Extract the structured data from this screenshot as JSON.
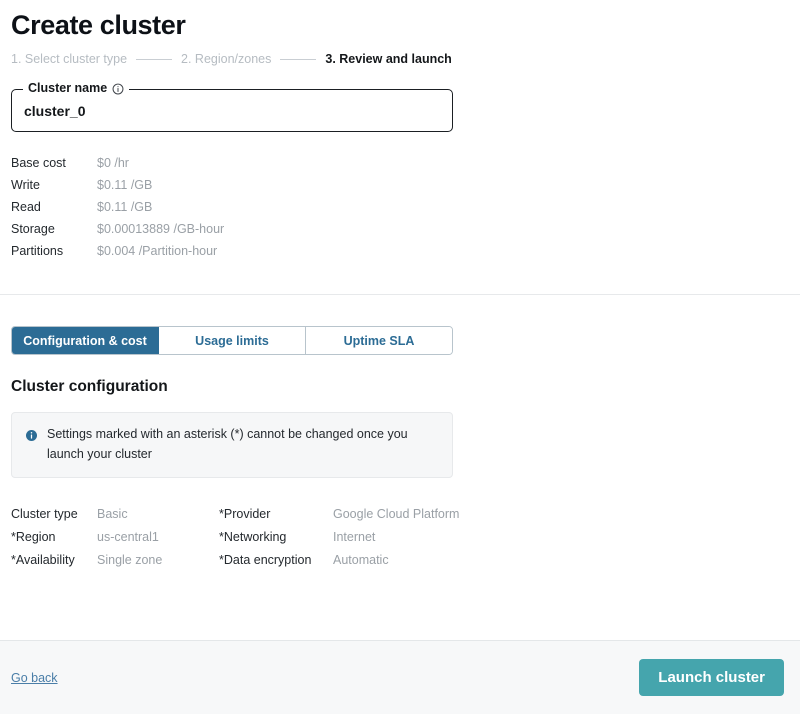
{
  "header": {
    "title": "Create cluster"
  },
  "stepper": {
    "steps": [
      {
        "label": "1. Select cluster type",
        "active": false
      },
      {
        "label": "2. Region/zones",
        "active": false
      },
      {
        "label": "3. Review and launch",
        "active": true
      }
    ]
  },
  "cluster_name_field": {
    "legend": "Cluster name",
    "info_icon": "info-circle-outline-icon",
    "value": "cluster_0",
    "placeholder": "Cluster name"
  },
  "pricing": {
    "rows": [
      {
        "label": "Base cost",
        "value": "$0 /hr"
      },
      {
        "label": "Write",
        "value": "$0.11 /GB"
      },
      {
        "label": "Read",
        "value": "$0.11 /GB"
      },
      {
        "label": "Storage",
        "value": "$0.00013889 /GB-hour"
      },
      {
        "label": "Partitions",
        "value": "$0.004 /Partition-hour"
      }
    ]
  },
  "tabs": {
    "items": [
      {
        "label": "Configuration & cost",
        "active": true
      },
      {
        "label": "Usage limits",
        "active": false
      },
      {
        "label": "Uptime SLA",
        "active": false
      }
    ],
    "active_color": "#2c6c95"
  },
  "configuration": {
    "section_title": "Cluster configuration",
    "callout": {
      "icon": "info-circle-filled-icon",
      "text": "Settings marked with an asterisk (*) cannot be changed once you launch your cluster"
    },
    "rows": [
      {
        "left_label": "Cluster type",
        "left_value": "Basic",
        "right_label": "*Provider",
        "right_value": "Google Cloud Platform"
      },
      {
        "left_label": "*Region",
        "left_value": "us-central1",
        "right_label": "*Networking",
        "right_value": "Internet"
      },
      {
        "left_label": "*Availability",
        "left_value": "Single zone",
        "right_label": "*Data encryption",
        "right_value": "Automatic"
      }
    ]
  },
  "footer": {
    "go_back_label": "Go back",
    "launch_label": "Launch cluster",
    "launch_color": "#45a5ad"
  }
}
